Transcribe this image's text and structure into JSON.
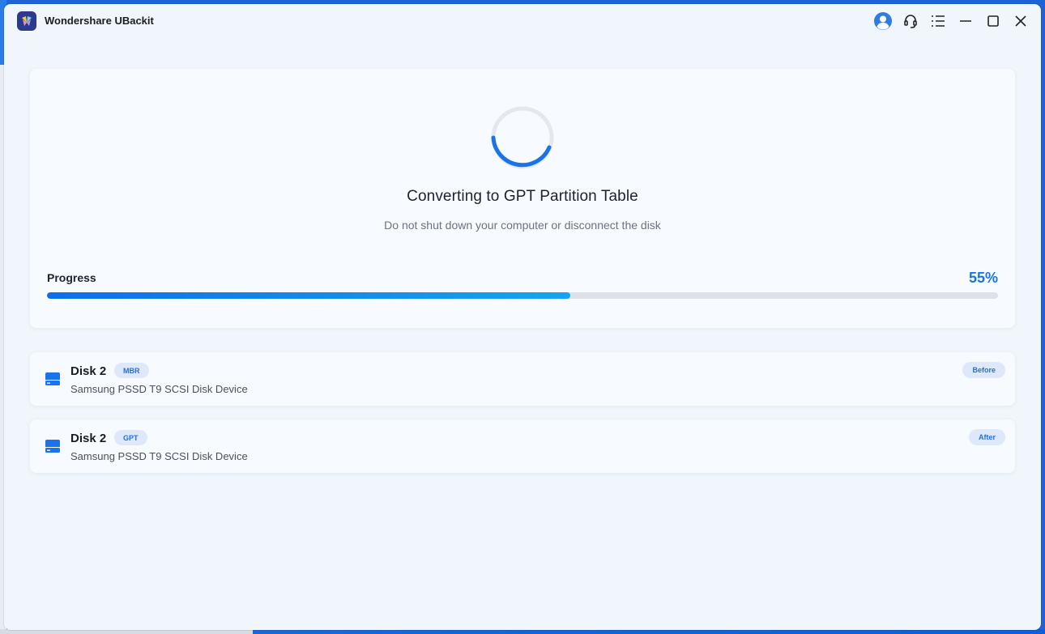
{
  "window": {
    "app_title": "Wondershare UBackit",
    "controls": [
      "account-icon",
      "support-icon",
      "menu-icon",
      "minimize-icon",
      "maximize-icon",
      "close-icon"
    ]
  },
  "progress": {
    "title": "Converting to GPT Partition Table",
    "subtitle": "Do not shut down your computer or disconnect the disk",
    "label": "Progress",
    "percent_text": "55%",
    "percent": 55
  },
  "disks": [
    {
      "name": "Disk 2",
      "type": "MBR",
      "description": "Samsung PSSD T9 SCSI Disk Device",
      "state": "Before"
    },
    {
      "name": "Disk 2",
      "type": "GPT",
      "description": "Samsung PSSD T9 SCSI Disk Device",
      "state": "After"
    }
  ],
  "colors": {
    "accent": "#1a73e8",
    "pill_bg": "#dde9fb",
    "window_bg": "#f1f6fd"
  }
}
